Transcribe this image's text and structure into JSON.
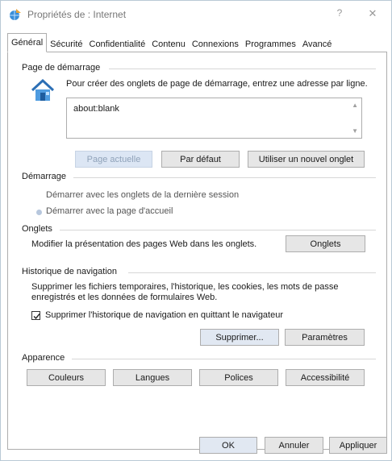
{
  "window": {
    "title": "Propriétés de : Internet",
    "help": "?",
    "close": "✕"
  },
  "tabs": [
    "Général",
    "Sécurité",
    "Confidentialité",
    "Contenu",
    "Connexions",
    "Programmes",
    "Avancé"
  ],
  "homepage": {
    "title": "Page de démarrage",
    "description": "Pour créer des onglets de page de démarrage, entrez une adresse par ligne.",
    "value": "about:blank",
    "current_btn": "Page actuelle",
    "default_btn": "Par défaut",
    "newtab_btn": "Utiliser un nouvel onglet"
  },
  "startup": {
    "title": "Démarrage",
    "option1": "Démarrer avec les onglets de la dernière session",
    "option2": "Démarrer avec la page d'accueil"
  },
  "tabs_group": {
    "title": "Onglets",
    "description": "Modifier la présentation des pages Web dans les onglets.",
    "button": "Onglets"
  },
  "history": {
    "title": "Historique de navigation",
    "description_line1": "Supprimer les fichiers temporaires, l'historique, les cookies, les mots de passe",
    "description_line2": "enregistrés et les données de formulaires Web.",
    "checkbox_label": "Supprimer l'historique de navigation en quittant le navigateur",
    "delete_btn": "Supprimer...",
    "settings_btn": "Paramètres"
  },
  "appearance": {
    "title": "Apparence",
    "colors_btn": "Couleurs",
    "languages_btn": "Langues",
    "fonts_btn": "Polices",
    "accessibility_btn": "Accessibilité"
  },
  "footer": {
    "ok": "OK",
    "cancel": "Annuler",
    "apply": "Appliquer"
  }
}
